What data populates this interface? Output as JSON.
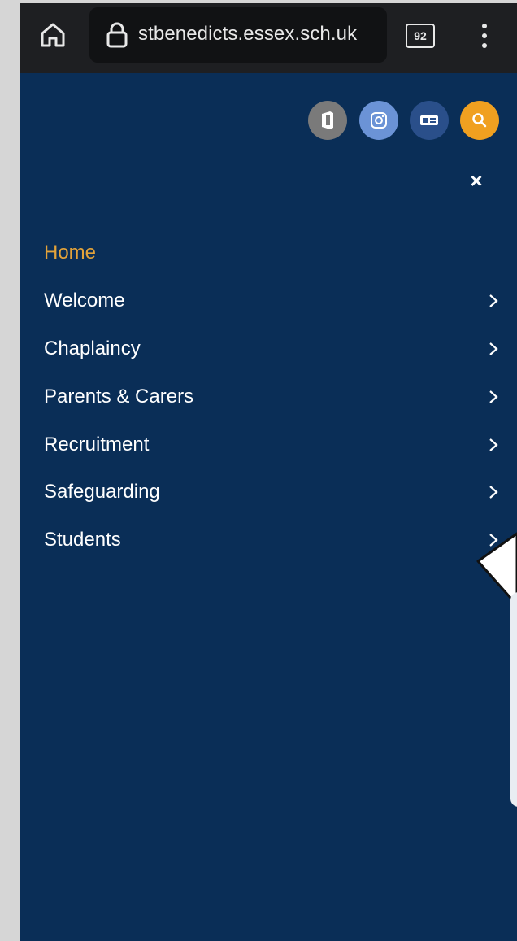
{
  "browser": {
    "url": "stbenedicts.essex.sch.uk",
    "tab_count": "92"
  },
  "header_icons": [
    "office-icon",
    "instagram-icon",
    "translate-icon",
    "search-icon"
  ],
  "colors": {
    "background": "#0a2e57",
    "active_link": "#e3a33a",
    "search_button": "#f0a020"
  },
  "close_label": "×",
  "nav": {
    "items": [
      {
        "label": "Home",
        "has_submenu": false,
        "active": true
      },
      {
        "label": "Welcome",
        "has_submenu": true
      },
      {
        "label": "Chaplaincy",
        "has_submenu": true
      },
      {
        "label": "Parents & Carers",
        "has_submenu": true
      },
      {
        "label": "Recruitment",
        "has_submenu": true
      },
      {
        "label": "Safeguarding",
        "has_submenu": true
      },
      {
        "label": "Students",
        "has_submenu": true
      }
    ]
  }
}
